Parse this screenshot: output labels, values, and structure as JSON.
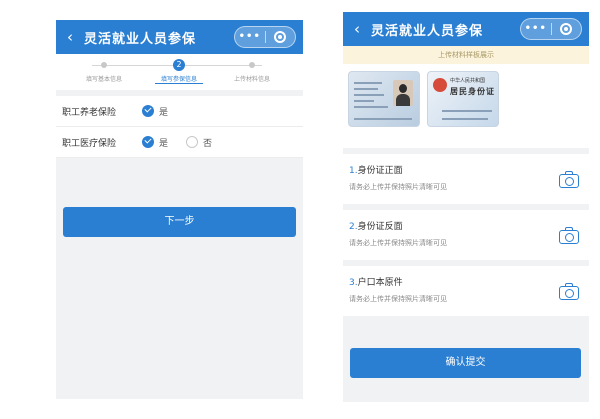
{
  "left_screen": {
    "nav": {
      "back": "‹",
      "title": "灵活就业人员参保",
      "more": "•••"
    },
    "steps": [
      {
        "number": "",
        "label": "填写基本信息",
        "active": false
      },
      {
        "number": "2",
        "label": "填写参保信息",
        "active": true
      },
      {
        "number": "",
        "label": "上传材料信息",
        "active": false
      }
    ],
    "pension": {
      "label": "职工养老保险",
      "yes": "是"
    },
    "medical": {
      "label": "职工医疗保险",
      "yes": "是",
      "no": "否"
    },
    "next_button": "下一步"
  },
  "right_screen": {
    "nav": {
      "back": "‹",
      "title": "灵活就业人员参保",
      "more": "•••"
    },
    "sample_hint": "上传材料样板展示",
    "id_back": {
      "country": "中华人民共和国",
      "title": "居民身份证"
    },
    "uploads": [
      {
        "num": "1.",
        "title": "身份证正面",
        "note": "请务必上传并保持照片清晰可见"
      },
      {
        "num": "2.",
        "title": "身份证反面",
        "note": "请务必上传并保持照片清晰可见"
      },
      {
        "num": "3.",
        "title": "户口本原件",
        "note": "请务必上传并保持照片清晰可见"
      }
    ],
    "submit_button": "确认提交"
  },
  "colors": {
    "primary": "#2b7fd2",
    "hint_bg": "#fbf3db",
    "page_bg": "#f1f2f4"
  }
}
